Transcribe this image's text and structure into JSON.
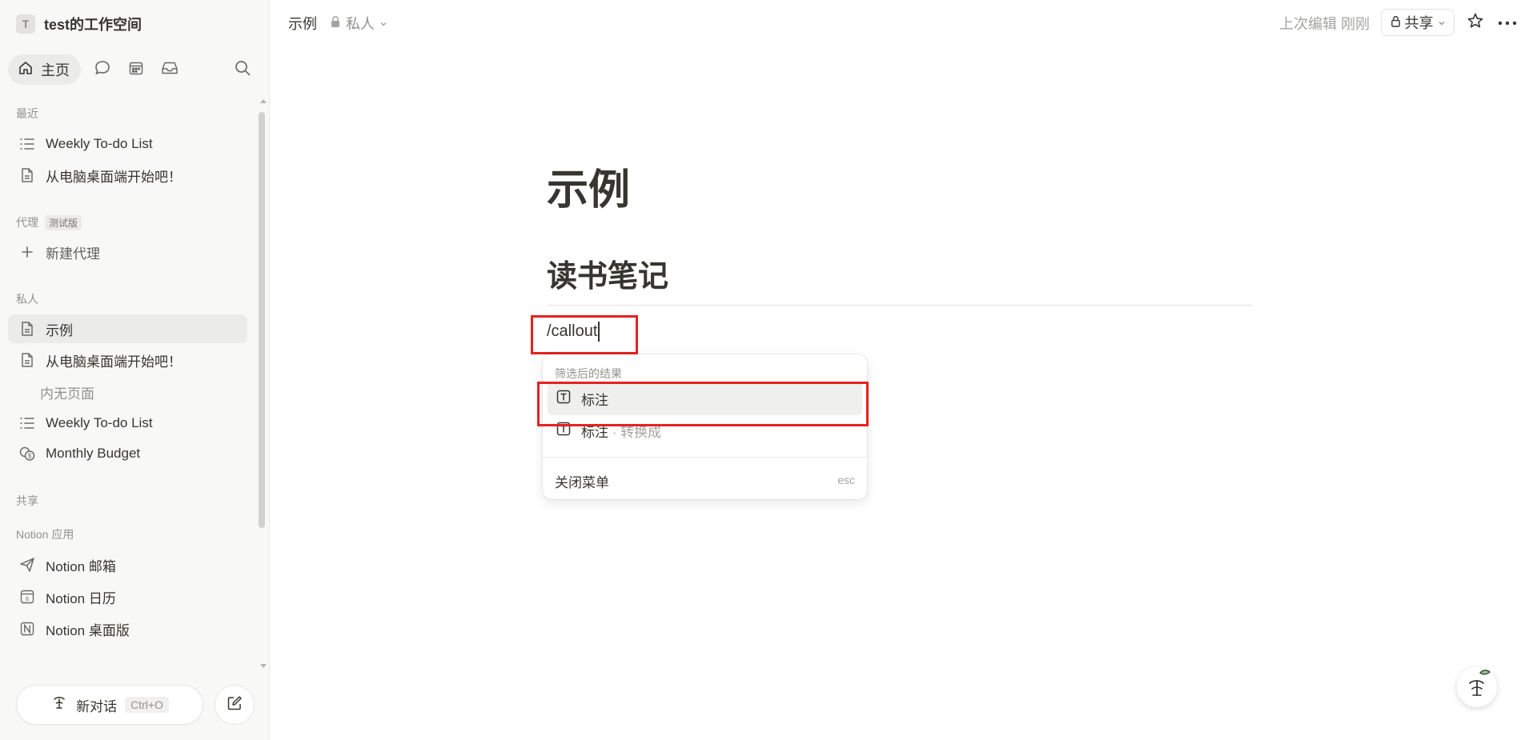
{
  "workspace": {
    "initial": "T",
    "name": "test的工作空间"
  },
  "nav": {
    "home_label": "主页"
  },
  "sidebar": {
    "recent_label": "最近",
    "recent": [
      "Weekly To-do List",
      "从电脑桌面端开始吧！"
    ],
    "agents_label": "代理",
    "beta_label": "测试版",
    "new_agent": "新建代理",
    "private_label": "私人",
    "private": [
      "示例",
      "从电脑桌面端开始吧！",
      "内无页面",
      "Weekly To-do List",
      "Monthly Budget"
    ],
    "shared_label": "共享",
    "apps_label": "Notion 应用",
    "apps": [
      "Notion 邮箱",
      "Notion 日历",
      "Notion 桌面版"
    ],
    "new_chat": "新对话",
    "new_chat_shortcut": "Ctrl+O"
  },
  "topbar": {
    "breadcrumb": "示例",
    "privacy": "私人",
    "last_edited": "上次编辑 刚刚",
    "share": "共享"
  },
  "page": {
    "title": "示例",
    "heading": "读书笔记",
    "command_text": "/callout"
  },
  "menu": {
    "header": "筛选后的结果",
    "items": [
      {
        "label": "标注"
      },
      {
        "label": "标注",
        "suffix": "· 转换成"
      }
    ],
    "close_label": "关闭菜单",
    "close_shortcut": "esc"
  }
}
